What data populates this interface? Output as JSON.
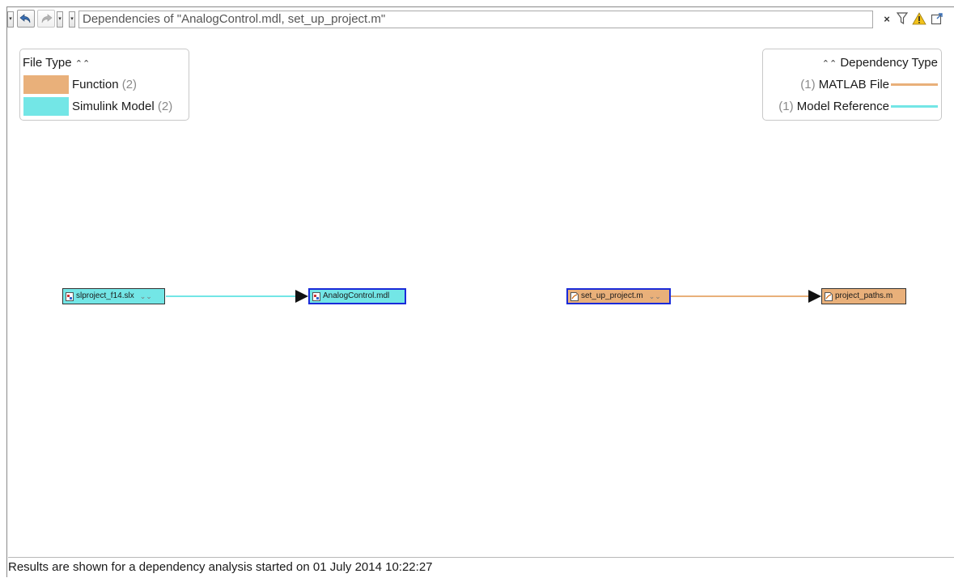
{
  "toolbar": {
    "address_text": "Dependencies of \"AnalogControl.mdl, set_up_project.m\"",
    "clear_label": "×"
  },
  "file_type_legend": {
    "title": "File Type",
    "items": [
      {
        "label": "Function",
        "count": "(2)",
        "color": "#e9b07a"
      },
      {
        "label": "Simulink Model",
        "count": "(2)",
        "color": "#73e6e6"
      }
    ]
  },
  "dependency_legend": {
    "title": "Dependency Type",
    "items": [
      {
        "label": "MATLAB File",
        "count": "(1)",
        "color": "#e9b07a"
      },
      {
        "label": "Model Reference",
        "count": "(1)",
        "color": "#73e6e6"
      }
    ]
  },
  "graph": {
    "nodes": [
      {
        "label": "slproject_f14.slx",
        "type": "simulink"
      },
      {
        "label": "AnalogControl.mdl",
        "type": "simulink"
      },
      {
        "label": "set_up_project.m",
        "type": "function"
      },
      {
        "label": "project_paths.m",
        "type": "function"
      }
    ]
  },
  "status_bar": {
    "text": "Results are shown for a dependency analysis started on 01 July 2014 10:22:27"
  }
}
